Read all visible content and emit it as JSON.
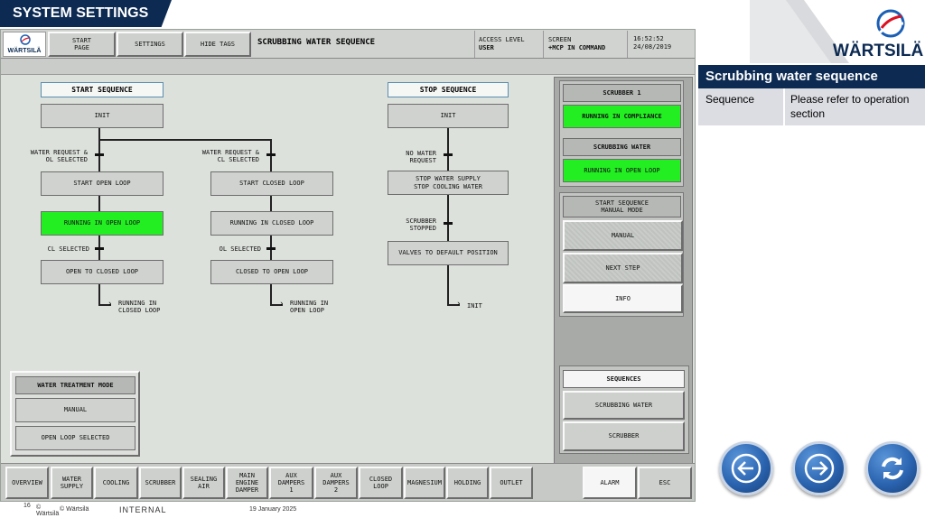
{
  "slide_title": "SYSTEM SETTINGS",
  "hmi": {
    "logo_text": "WÄRTSILÄ",
    "top_buttons": [
      "START\nPAGE",
      "SETTINGS",
      "HIDE TAGS"
    ],
    "screen_title": "SCRUBBING WATER SEQUENCE",
    "access_level_label": "ACCESS LEVEL",
    "access_level_value": "USER",
    "screen_label": "SCREEN",
    "screen_value": "+MCP IN COMMAND",
    "time": "16:52:52",
    "date": "24/08/2019",
    "start_sequence": {
      "title": "START SEQUENCE",
      "init": "INIT",
      "cond_left": "WATER REQUEST &\nOL SELECTED",
      "cond_right": "WATER REQUEST &\nCL SELECTED",
      "start_open": "START OPEN LOOP",
      "start_closed": "START CLOSED LOOP",
      "running_open": "RUNNING IN OPEN LOOP",
      "running_closed": "RUNNING IN CLOSED LOOP",
      "cl_selected": "CL SELECTED",
      "ol_selected": "OL SELECTED",
      "open_to_closed": "OPEN TO CLOSED LOOP",
      "closed_to_open": "CLOSED TO OPEN LOOP",
      "goto_left": "RUNNING IN\nCLOSED LOOP",
      "goto_right": "RUNNING IN\nOPEN LOOP"
    },
    "stop_sequence": {
      "title": "STOP SEQUENCE",
      "init": "INIT",
      "cond1": "NO WATER\nREQUEST",
      "step1": "STOP WATER SUPPLY\nSTOP COOLING WATER",
      "cond2": "SCRUBBER\nSTOPPED",
      "step2": "VALVES TO DEFAULT POSITION",
      "goto": "INIT"
    },
    "water_treatment": {
      "title": "WATER TREATMENT MODE",
      "manual": "MANUAL",
      "open_loop": "OPEN LOOP SELECTED"
    },
    "right_panel": {
      "scrubber_title": "SCRUBBER 1",
      "scrubber_status": "RUNNING IN COMPLIANCE",
      "water_title": "SCRUBBING WATER",
      "water_status": "RUNNING IN OPEN LOOP",
      "start_seq_title": "START SEQUENCE\nMANUAL MODE",
      "manual": "MANUAL",
      "next_step": "NEXT STEP",
      "info": "INFO",
      "sequences_title": "SEQUENCES",
      "seq_water": "SCRUBBING WATER",
      "seq_scrubber": "SCRUBBER"
    },
    "bottom_nav": [
      "OVERVIEW",
      "WATER\nSUPPLY",
      "COOLING",
      "SCRUBBER",
      "SEALING\nAIR",
      "MAIN\nENGINE\nDAMPER",
      "AUX\nDAMPERS\n1",
      "AUX\nDAMPERS\n2",
      "CLOSED\nLOOP",
      "MAGNESIUM",
      "HOLDING",
      "OUTLET"
    ],
    "alarm": "ALARM",
    "esc": "ESC"
  },
  "brand_logo_text": "WÄRTSILÄ",
  "info_table": {
    "title": "Scrubbing water sequence",
    "row_label": "Sequence",
    "row_value": "Please refer to operation section"
  },
  "nav_icons": [
    "arrow-left-icon",
    "arrow-right-icon",
    "refresh-icon"
  ],
  "footer": {
    "page": "16",
    "copyright_short": "©\nWärtsilä",
    "copyright": "© Wärtsilä",
    "classification": "INTERNAL",
    "date": "19 January 2025"
  },
  "colors": {
    "navy": "#0c2a52",
    "status_green": "#22ee22",
    "accent_blue": "#2b64b0"
  }
}
